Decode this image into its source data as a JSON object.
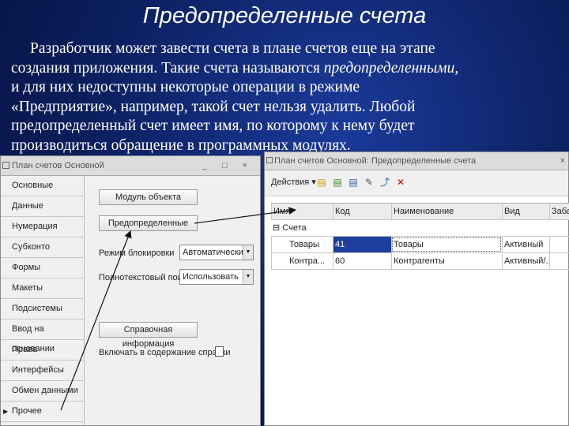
{
  "slide": {
    "title": "Предопределенные счета",
    "text_line1": "Разработчик может завести счета в плане счетов еще на этапе",
    "text_line2_a": "создания приложения. Такие счета называются ",
    "text_line2_b": "предопределенными,",
    "text_line3": "и для них недоступны некоторые операции в режиме",
    "text_line4": "«Предприятие», например, такой счет нельзя удалить. Любой",
    "text_line5": "предопределенный счет имеет имя, по которому к нему будет",
    "text_line6": "производиться обращение в программных модулях."
  },
  "left_window": {
    "title": "План счетов Основной",
    "controls": "_ □ ×",
    "sidebar": [
      "Основные",
      "Данные",
      "Нумерация",
      "Субконто",
      "Формы",
      "Макеты",
      "Подсистемы",
      "Ввод на основании",
      "Права",
      "Интерфейсы",
      "Обмен данными",
      "Прочее"
    ],
    "btn_module": "Модуль объекта",
    "btn_predefined": "Предопределенные",
    "label_lock_mode": "Режим блокировки",
    "lock_mode_value": "Автоматический",
    "label_fulltext": "Полнотекстовый поиск",
    "fulltext_value": "Использовать",
    "btn_help": "Справочная информация",
    "label_include_help": "Включать в содержание справки"
  },
  "right_window": {
    "title": "План счетов Основной: Предопределенные счета",
    "actions_label": "Действия ▾",
    "columns": [
      "Имя",
      "Код",
      "Наименование",
      "Вид",
      "Забал"
    ],
    "tree_root": "⊟ Счета",
    "rows": [
      {
        "name": "Товары",
        "code": "41",
        "title": "Товары",
        "kind": "Активный"
      },
      {
        "name": "Контра...",
        "code": "60",
        "title": "Контрагенты",
        "kind": "Активный/..."
      }
    ]
  }
}
